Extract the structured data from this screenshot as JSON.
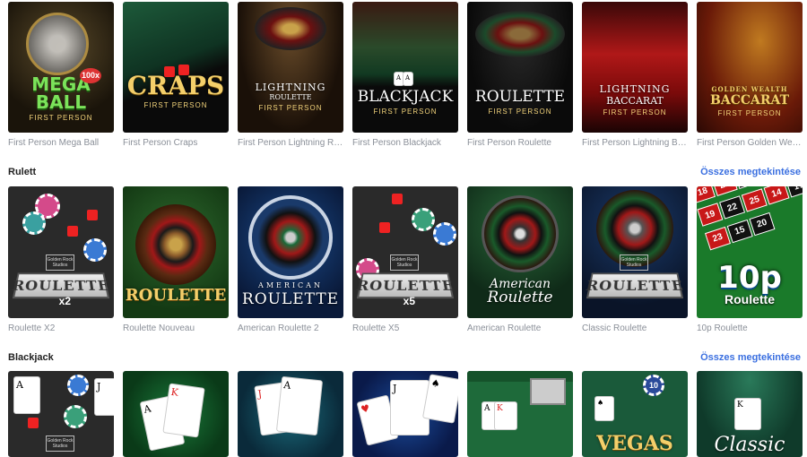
{
  "top_row": [
    {
      "caption": "First Person Mega Ball",
      "logo": "MEGA BALL",
      "badge": "100x",
      "sub": "FIRST PERSON"
    },
    {
      "caption": "First Person Craps",
      "logo": "CRAPS",
      "sub": "FIRST PERSON"
    },
    {
      "caption": "First Person Lightning Ro...",
      "logo": "LIGHTNING",
      "logo2": "ROULETTE",
      "sub": "FIRST PERSON"
    },
    {
      "caption": "First Person Blackjack",
      "logo": "BLACKJACK",
      "sub": "FIRST PERSON"
    },
    {
      "caption": "First Person Roulette",
      "logo": "ROULETTE",
      "sub": "FIRST PERSON"
    },
    {
      "caption": "First Person Lightning Ba...",
      "logo": "LIGHTNING",
      "logo2": "BACCARAT",
      "sub": "FIRST PERSON"
    },
    {
      "caption": "First Person Golden Weal...",
      "logo": "GOLDEN WEALTH",
      "logo2": "BACCARAT",
      "sub": "FIRST PERSON"
    }
  ],
  "sections": [
    {
      "title": "Rulett",
      "see_all": "Összes megtekintése",
      "games": [
        {
          "caption": "Roulette X2",
          "logo": "ROULETTE",
          "mult": "x2",
          "studio": "Golden Rock Studios"
        },
        {
          "caption": "Roulette Nouveau",
          "logo": "ROULETTE"
        },
        {
          "caption": "American Roulette 2",
          "logo": "AMERICAN",
          "logo2": "ROULETTE"
        },
        {
          "caption": "Roulette X5",
          "logo": "ROULETTE",
          "mult": "x5",
          "studio": "Golden Rock Studios"
        },
        {
          "caption": "American Roulette",
          "logo": "American",
          "logo2": "Roulette"
        },
        {
          "caption": "Classic Roulette",
          "logo": "ROULETTE",
          "studio": "Golden Rock Studios"
        },
        {
          "caption": "10p Roulette",
          "logo": "10p",
          "logo2": "Roulette",
          "numbers": [
            "18",
            "21",
            "24",
            "26",
            "16",
            "19",
            "22",
            "25",
            "14",
            "17",
            "23",
            "15",
            "20"
          ]
        }
      ]
    },
    {
      "title": "Blackjack",
      "see_all": "Összes megtekintése",
      "games": [
        {
          "caption": "",
          "studio": "Golden Rock Studios",
          "cards": [
            "A",
            "J"
          ]
        },
        {
          "caption": "",
          "cards": [
            "A",
            "K"
          ]
        },
        {
          "caption": "",
          "cards": [
            "J",
            "A"
          ]
        },
        {
          "caption": "",
          "cards": [
            "J",
            "A"
          ]
        },
        {
          "caption": "",
          "cards": [
            "A",
            "K"
          ]
        },
        {
          "caption": "",
          "logo": "VEGAS",
          "chip": "10"
        },
        {
          "caption": "",
          "logo": "Classic"
        }
      ]
    }
  ],
  "colors": {
    "link": "#3a6fe0",
    "caption": "#8a8f98",
    "title": "#222222"
  }
}
